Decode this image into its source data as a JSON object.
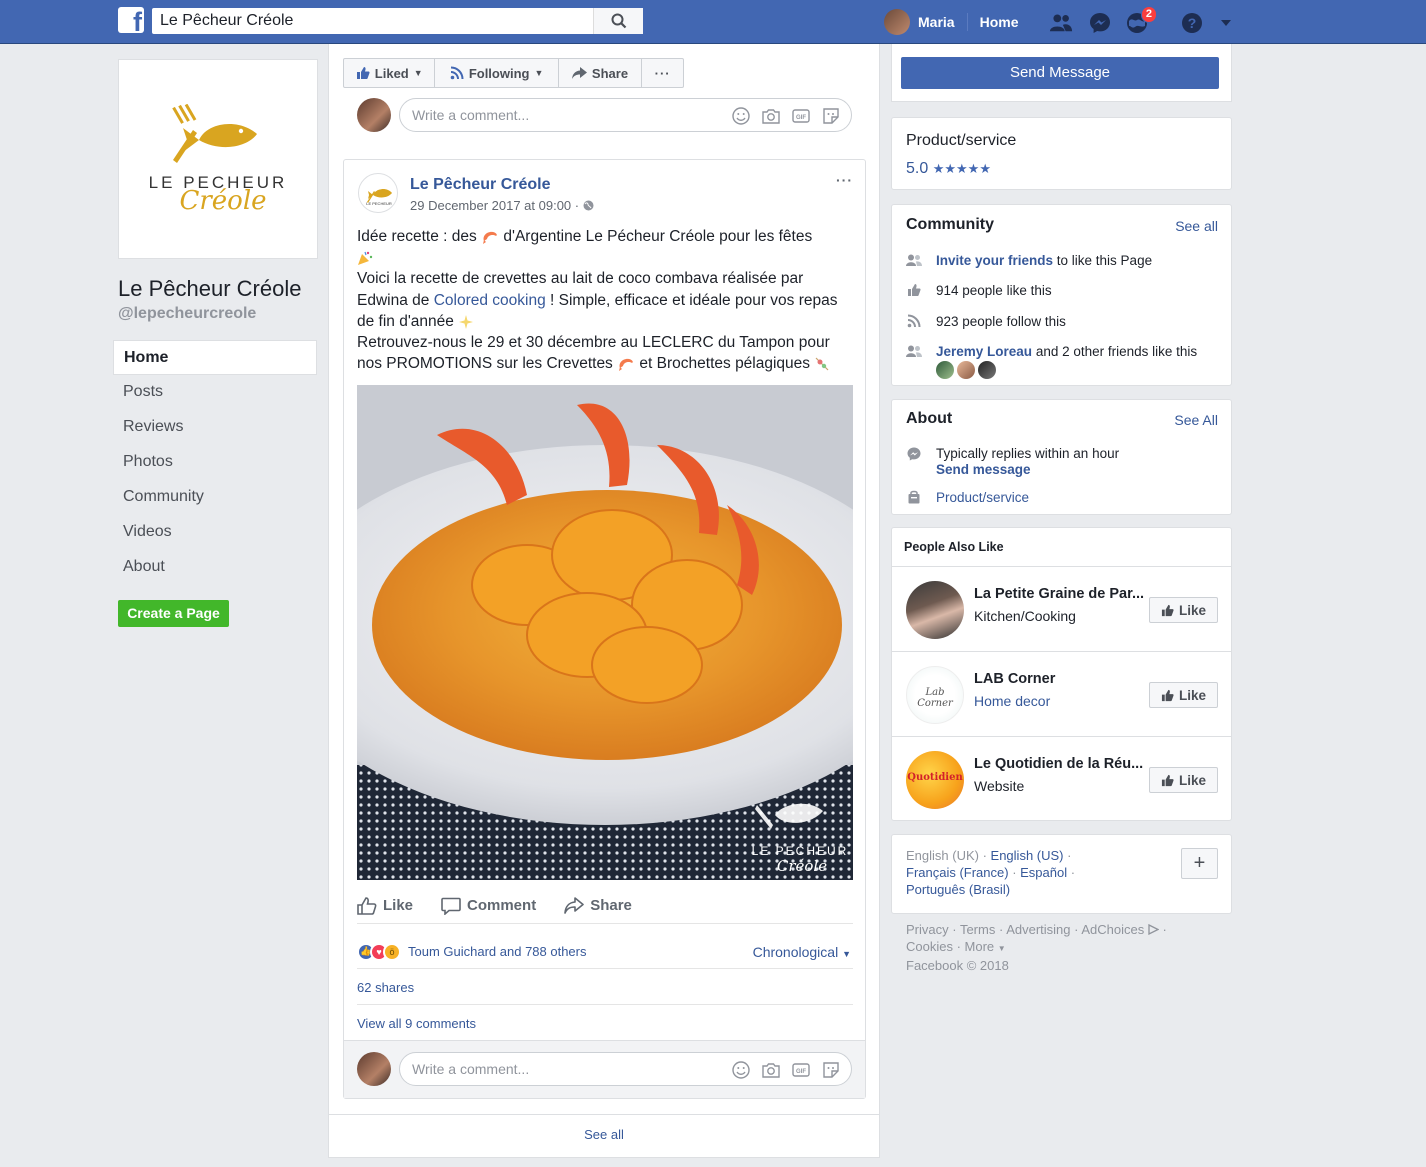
{
  "topbar": {
    "search_value": "Le Pêcheur Créole",
    "search_placeholder": "Search",
    "user_name": "Maria",
    "home_label": "Home",
    "notifications_count": "2"
  },
  "left": {
    "page_name": "Le Pêcheur Créole",
    "page_handle": "@lepecheurcreole",
    "logo_line1": "LE PECHEUR",
    "logo_line2": "Créole",
    "nav": [
      "Home",
      "Posts",
      "Reviews",
      "Photos",
      "Community",
      "Videos",
      "About"
    ],
    "create_page_label": "Create a Page"
  },
  "actions": {
    "liked": "Liked",
    "following": "Following",
    "share": "Share",
    "more": "···"
  },
  "comment_placeholder": "Write a comment...",
  "post": {
    "author": "Le Pêcheur Créole",
    "time": "29 December 2017 at 09:00 · ",
    "menu": "···",
    "text_l1a": "Idée recette : des ",
    "text_l1b": " d'Argentine Le Pécheur Créole pour les fêtes",
    "text_l2a": "Voici la recette de crevettes au lait de coco combava réalisée par Edwina de ",
    "text_l2link": "Colored cooking",
    "text_l2b": " ! Simple, efficace et idéale pour vos repas de fin d'année ",
    "text_l3a": "Retrouvez-nous le 29 et 30 décembre au LECLERC du Tampon pour nos PROMOTIONS sur les Crevettes ",
    "text_l3b": " et Brochettes pélagiques ",
    "image_watermark_1": "LE PECHEUR",
    "image_watermark_2": "Créole",
    "like_label": "Like",
    "comment_label": "Comment",
    "share_label": "Share",
    "reactions_text": "Toum Guichard and 788 others",
    "chronological": "Chronological",
    "shares": "62 shares",
    "view_comments": "View all 9 comments"
  },
  "see_all_bottom": "See all",
  "right": {
    "send_message": "Send Message",
    "category": "Product/service",
    "rating": "5.0",
    "stars": "★★★★★",
    "community": {
      "title": "Community",
      "see_all": "See all",
      "invite_link": "Invite your friends",
      "invite_rest": " to like this Page",
      "likes": "914 people like this",
      "follows": "923 people follow this",
      "friend_link": "Jeremy Loreau",
      "friend_rest": " and 2 other friends like this"
    },
    "about": {
      "title": "About",
      "see_all": "See All",
      "replies": "Typically replies within an hour",
      "send_message": "Send message",
      "category": "Product/service"
    },
    "people_also_like": {
      "title": "People Also Like",
      "pages": [
        {
          "name": "La Petite Graine de Par...",
          "category": "Kitchen/Cooking",
          "like": "Like"
        },
        {
          "name": "LAB Corner",
          "category": "Home decor",
          "like": "Like"
        },
        {
          "name": "Le Quotidien de la Réu...",
          "category": "Website",
          "like": "Like"
        }
      ],
      "lab_logo_text": "Lab Corner",
      "quotidien_logo_text": "Quotidien"
    },
    "languages": {
      "english_uk": "English (UK)",
      "english_us": "English (US)",
      "francais": "Français (France)",
      "espanol": "Español",
      "portugues": "Português (Brasil)",
      "plus": "+"
    },
    "footer": {
      "privacy": "Privacy",
      "terms": "Terms",
      "advertising": "Advertising",
      "adchoices": "AdChoices",
      "cookies": "Cookies",
      "more": "More",
      "copyright": "Facebook © 2018"
    }
  },
  "colors": {
    "brand_blue": "#4267b2",
    "link_blue": "#365899",
    "green": "#42b72a",
    "logo_gold": "#d9a520"
  }
}
